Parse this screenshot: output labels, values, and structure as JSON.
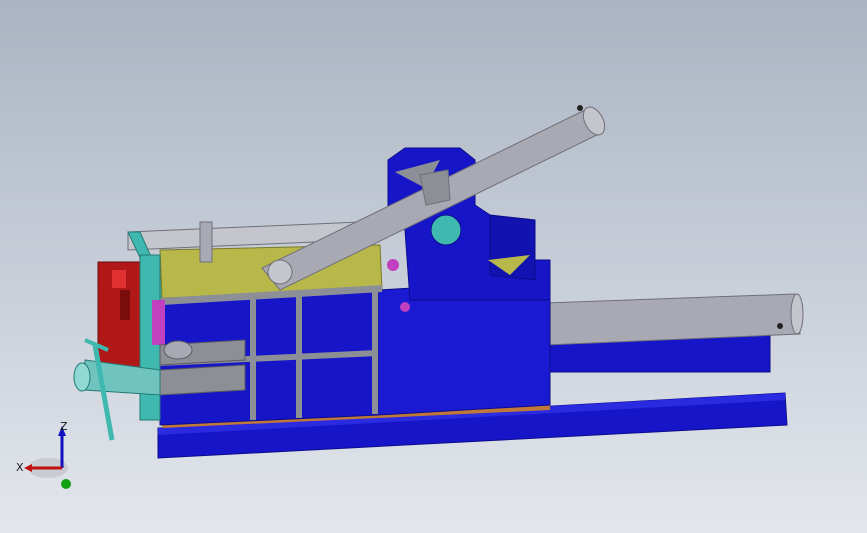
{
  "viewport": {
    "model": "hydraulic-scrap-baler-assembly",
    "background_top": "#aab4c2",
    "background_bottom": "#e3e6ec"
  },
  "colors": {
    "body_blue": "#1616c8",
    "body_blue_dark": "#0c0c8a",
    "cylinder_grey": "#a9a9b3",
    "plate_olive": "#b8b84a",
    "accent_teal": "#3fb8b0",
    "accent_red": "#b01818",
    "accent_magenta": "#c040c0",
    "rail_orange": "#c0783a",
    "steel_grey": "#8d8f96"
  },
  "triad": {
    "x_label": "X",
    "z_label": "Z",
    "x_color": "#c01010",
    "z_color": "#1010c0",
    "y_color": "#10a010"
  }
}
